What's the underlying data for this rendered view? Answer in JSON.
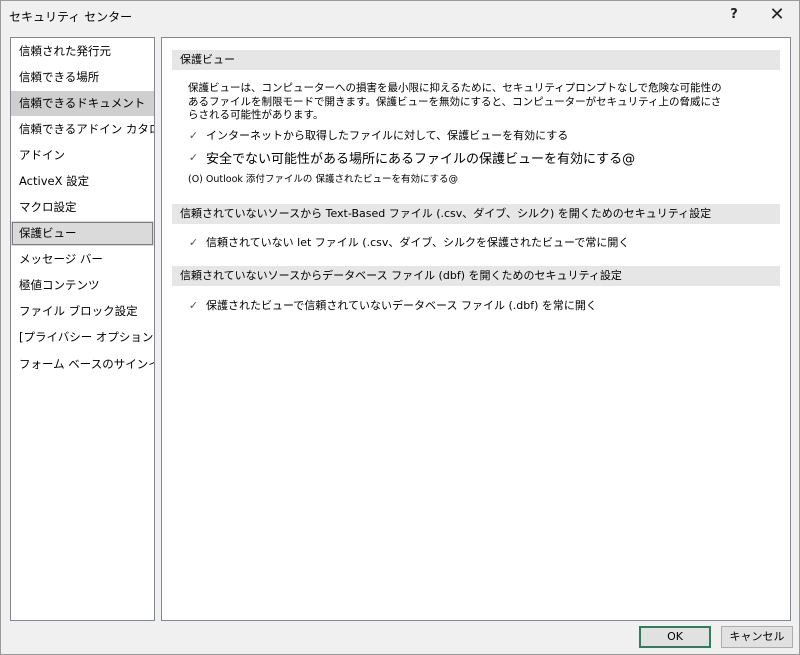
{
  "window": {
    "title": "セキュリティ センター",
    "help_label": "?",
    "close_label": "✕"
  },
  "sidebar": {
    "items": [
      {
        "label": "信頼された発行元"
      },
      {
        "label": "信頼できる場所"
      },
      {
        "label": "信頼できるドキュメント"
      },
      {
        "label": "信頼できるアドイン カタログ"
      },
      {
        "label": "アドイン"
      },
      {
        "label": "ActiveX 設定"
      },
      {
        "label": "マクロ設定"
      },
      {
        "label": "保護ビュー"
      },
      {
        "label": "メッセージ バー"
      },
      {
        "label": "極値コンテンツ"
      },
      {
        "label": "ファイル ブロック設定"
      },
      {
        "label": "[プライバシー オプション]"
      },
      {
        "label": "フォーム ベースのサインイン"
      }
    ],
    "hovered_index": 2,
    "selected_index": 7
  },
  "protected_view": {
    "header": "保護ビュー",
    "description": "保護ビューは、コンピューターへの損害を最小限に抑えるために、セキュリティプロンプトなしで危険な可能性のあるファイルを制限モードで開きます。保護ビューを無効にすると、コンピューターがセキュリティ上の脅威にさらされる可能性があります。",
    "options": [
      {
        "label": "インターネットから取得したファイルに対して、保護ビューを有効にする",
        "checked": true
      },
      {
        "label": "安全でない可能性がある場所にあるファイルの保護ビューを有効にする@",
        "checked": true
      }
    ],
    "outlook_option": "(O) Outlook 添付ファイルの 保護されたビューを有効にする@"
  },
  "text_based": {
    "header": "信頼されていないソースから Text-Based ファイル (.csv、ダイブ、シルク) を開くためのセキュリティ設定",
    "option": {
      "label": "信頼されていない let ファイル (.csv、ダイブ、シルクを保護されたビューで常に開く",
      "checked": true
    }
  },
  "database": {
    "header": "信頼されていないソースからデータベース ファイル (dbf) を開くためのセキュリティ設定",
    "option": {
      "label": "保護されたビューで信頼されていないデータベース ファイル (.dbf) を常に開く",
      "checked": true
    }
  },
  "buttons": {
    "ok": "OK",
    "cancel": "キャンセル"
  },
  "icons": {
    "checkmark": "✓"
  }
}
